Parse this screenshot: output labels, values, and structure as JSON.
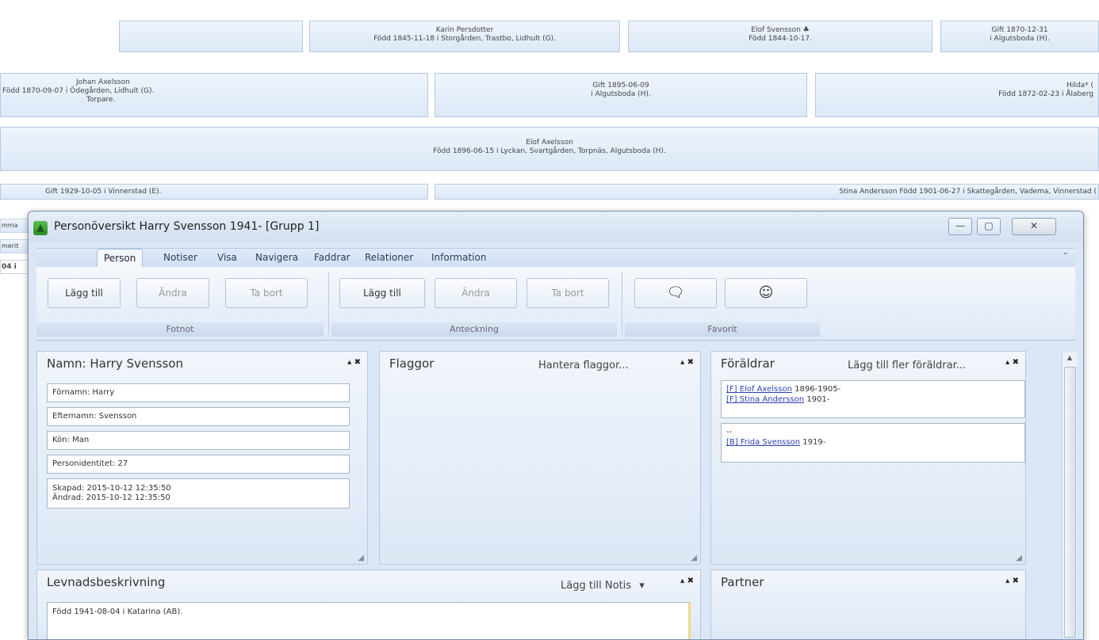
{
  "tree": {
    "row1": {
      "box2": [
        "Karin Persdotter",
        "Född 1845-11-18 i Storgården, Trastbo, Lidhult (G)."
      ],
      "box3": [
        "Elof Svensson ♣",
        "Född 1844-10-17."
      ],
      "box4": [
        "Gift 1870-12-31",
        "i Algutsboda (H)."
      ]
    },
    "row2": {
      "box1": [
        "Johan Axelsson",
        "Född 1870-09-07 i Ödegården, Lidhult (G).",
        "Torpare."
      ],
      "box2": [
        "Gift 1895-06-09",
        "i Algutsboda (H)."
      ],
      "box3": [
        "Hilda* (",
        "Född 1872-02-23 i Ålaberg"
      ]
    },
    "row3": [
      "Elof Axelsson",
      "Född 1896-06-15 i Lyckan, Svartgården, Torpnäs, Algutsboda (H)."
    ],
    "row4": {
      "box1": "Gift 1929-10-05 i Vinnerstad (E).",
      "box2": "Stina Andersson Född 1901-06-27 i Skattegården, Vadema, Vinnerstad ("
    },
    "edge": [
      "mma",
      "merit",
      "04 i"
    ]
  },
  "window": {
    "title": "Personöversikt Harry Svensson 1941- [Grupp 1]",
    "controls": [
      "—",
      "▢",
      "✕"
    ]
  },
  "ribbon": {
    "tabs": [
      "Person",
      "Notiser",
      "Visa",
      "Navigera",
      "Faddrar",
      "Relationer",
      "Information"
    ],
    "collapse": "⌃",
    "fotnot": {
      "add": "Lägg till",
      "edit": "Ändra",
      "delete": "Ta bort",
      "label": "Fotnot"
    },
    "anteckning": {
      "add": "Lägg till",
      "edit": "Ändra",
      "delete": "Ta bort",
      "label": "Anteckning"
    },
    "favorit": {
      "label": "Favorit",
      "icon1": "🗨",
      "icon2": "☺"
    }
  },
  "name_panel": {
    "title": "Namn: Harry Svensson",
    "controls": "▴ ✖",
    "fields": [
      "Förnamn: Harry",
      "Efternamn: Svensson",
      "Kön: Man",
      "Personidentitet: 27"
    ],
    "created": "Skapad: 2015-10-12 12:35:50",
    "changed": "Ändrad: 2015-10-12 12:35:50"
  },
  "flags_panel": {
    "title": "Flaggor",
    "link": "Hantera flaggor...",
    "controls": "▴ ✖"
  },
  "parents_panel": {
    "title": "Föräldrar",
    "link": "Lägg till fler föräldrar...",
    "controls": "▴ ✖",
    "parents": [
      {
        "prefix": "[F]",
        "name": "Elof Axelsson",
        "years": "1896-1905-"
      },
      {
        "prefix": "[F]",
        "name": "Stina Andersson",
        "years": "1901-"
      }
    ],
    "siblings_dash": "--",
    "siblings": [
      {
        "prefix": "[B]",
        "name": "Frida Svensson",
        "years": "1919-"
      }
    ]
  },
  "bio_panel": {
    "title": "Levnadsbeskrivning",
    "link": "Lägg till Notis",
    "dropdown": "▾",
    "controls": "▴ ✖",
    "text": "Född 1941-08-04 i Katarina (AB)."
  },
  "partner_panel": {
    "title": "Partner",
    "controls": "▴ ✖"
  }
}
